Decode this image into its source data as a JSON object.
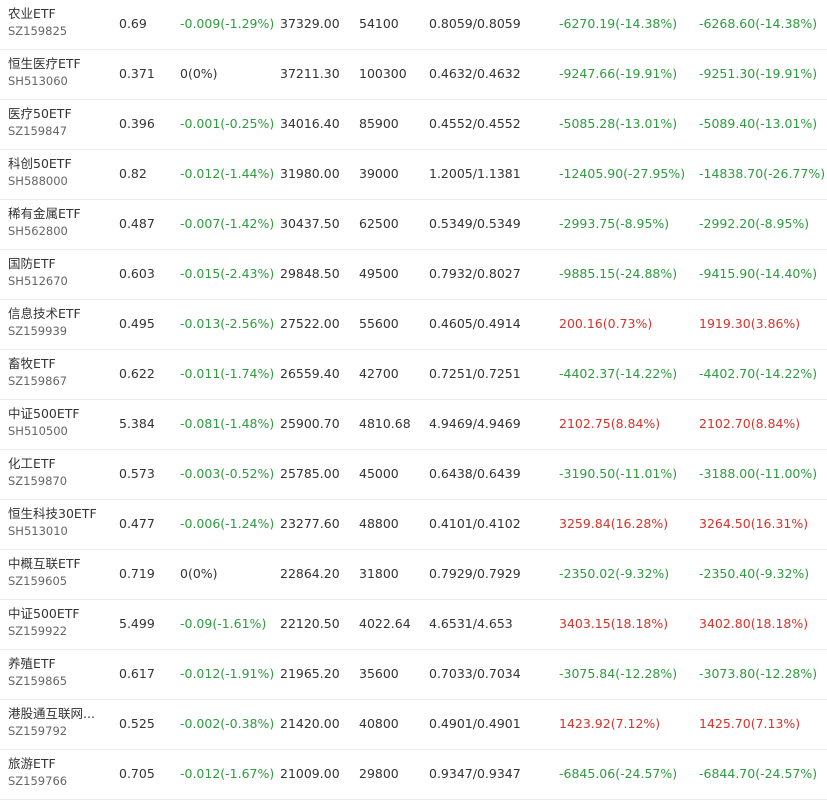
{
  "colors": {
    "up": "#d6332a",
    "down": "#2e9b3e",
    "flat": "#333333"
  },
  "rows": [
    {
      "name": "农业ETF",
      "code": "SZ159825",
      "price": "0.69",
      "change": "-0.009(-1.29%)",
      "change_dir": "down",
      "market_value": "37329.00",
      "shares": "54100",
      "cost": "0.8059/0.8059",
      "pnl1": "-6270.19(-14.38%)",
      "pnl1_dir": "down",
      "pnl2": "-6268.60(-14.38%)",
      "pnl2_dir": "down"
    },
    {
      "name": "恒生医疗ETF",
      "code": "SH513060",
      "price": "0.371",
      "change": "0(0%)",
      "change_dir": "flat",
      "market_value": "37211.30",
      "shares": "100300",
      "cost": "0.4632/0.4632",
      "pnl1": "-9247.66(-19.91%)",
      "pnl1_dir": "down",
      "pnl2": "-9251.30(-19.91%)",
      "pnl2_dir": "down"
    },
    {
      "name": "医疗50ETF",
      "code": "SZ159847",
      "price": "0.396",
      "change": "-0.001(-0.25%)",
      "change_dir": "down",
      "market_value": "34016.40",
      "shares": "85900",
      "cost": "0.4552/0.4552",
      "pnl1": "-5085.28(-13.01%)",
      "pnl1_dir": "down",
      "pnl2": "-5089.40(-13.01%)",
      "pnl2_dir": "down"
    },
    {
      "name": "科创50ETF",
      "code": "SH588000",
      "price": "0.82",
      "change": "-0.012(-1.44%)",
      "change_dir": "down",
      "market_value": "31980.00",
      "shares": "39000",
      "cost": "1.2005/1.1381",
      "pnl1": "-12405.90(-27.95%)",
      "pnl1_dir": "down",
      "pnl2": "-14838.70(-26.77%)",
      "pnl2_dir": "down"
    },
    {
      "name": "稀有金属ETF",
      "code": "SH562800",
      "price": "0.487",
      "change": "-0.007(-1.42%)",
      "change_dir": "down",
      "market_value": "30437.50",
      "shares": "62500",
      "cost": "0.5349/0.5349",
      "pnl1": "-2993.75(-8.95%)",
      "pnl1_dir": "down",
      "pnl2": "-2992.20(-8.95%)",
      "pnl2_dir": "down"
    },
    {
      "name": "国防ETF",
      "code": "SH512670",
      "price": "0.603",
      "change": "-0.015(-2.43%)",
      "change_dir": "down",
      "market_value": "29848.50",
      "shares": "49500",
      "cost": "0.7932/0.8027",
      "pnl1": "-9885.15(-24.88%)",
      "pnl1_dir": "down",
      "pnl2": "-9415.90(-14.40%)",
      "pnl2_dir": "down"
    },
    {
      "name": "信息技术ETF",
      "code": "SZ159939",
      "price": "0.495",
      "change": "-0.013(-2.56%)",
      "change_dir": "down",
      "market_value": "27522.00",
      "shares": "55600",
      "cost": "0.4605/0.4914",
      "pnl1": "200.16(0.73%)",
      "pnl1_dir": "up",
      "pnl2": "1919.30(3.86%)",
      "pnl2_dir": "up"
    },
    {
      "name": "畜牧ETF",
      "code": "SZ159867",
      "price": "0.622",
      "change": "-0.011(-1.74%)",
      "change_dir": "down",
      "market_value": "26559.40",
      "shares": "42700",
      "cost": "0.7251/0.7251",
      "pnl1": "-4402.37(-14.22%)",
      "pnl1_dir": "down",
      "pnl2": "-4402.70(-14.22%)",
      "pnl2_dir": "down"
    },
    {
      "name": "中证500ETF",
      "code": "SH510500",
      "price": "5.384",
      "change": "-0.081(-1.48%)",
      "change_dir": "down",
      "market_value": "25900.70",
      "shares": "4810.68",
      "cost": "4.9469/4.9469",
      "pnl1": "2102.75(8.84%)",
      "pnl1_dir": "up",
      "pnl2": "2102.70(8.84%)",
      "pnl2_dir": "up"
    },
    {
      "name": "化工ETF",
      "code": "SZ159870",
      "price": "0.573",
      "change": "-0.003(-0.52%)",
      "change_dir": "down",
      "market_value": "25785.00",
      "shares": "45000",
      "cost": "0.6438/0.6439",
      "pnl1": "-3190.50(-11.01%)",
      "pnl1_dir": "down",
      "pnl2": "-3188.00(-11.00%)",
      "pnl2_dir": "down"
    },
    {
      "name": "恒生科技30ETF",
      "code": "SH513010",
      "price": "0.477",
      "change": "-0.006(-1.24%)",
      "change_dir": "down",
      "market_value": "23277.60",
      "shares": "48800",
      "cost": "0.4101/0.4102",
      "pnl1": "3259.84(16.28%)",
      "pnl1_dir": "up",
      "pnl2": "3264.50(16.31%)",
      "pnl2_dir": "up"
    },
    {
      "name": "中概互联ETF",
      "code": "SZ159605",
      "price": "0.719",
      "change": "0(0%)",
      "change_dir": "flat",
      "market_value": "22864.20",
      "shares": "31800",
      "cost": "0.7929/0.7929",
      "pnl1": "-2350.02(-9.32%)",
      "pnl1_dir": "down",
      "pnl2": "-2350.40(-9.32%)",
      "pnl2_dir": "down"
    },
    {
      "name": "中证500ETF",
      "code": "SZ159922",
      "price": "5.499",
      "change": "-0.09(-1.61%)",
      "change_dir": "down",
      "market_value": "22120.50",
      "shares": "4022.64",
      "cost": "4.6531/4.653",
      "pnl1": "3403.15(18.18%)",
      "pnl1_dir": "up",
      "pnl2": "3402.80(18.18%)",
      "pnl2_dir": "up"
    },
    {
      "name": "养殖ETF",
      "code": "SZ159865",
      "price": "0.617",
      "change": "-0.012(-1.91%)",
      "change_dir": "down",
      "market_value": "21965.20",
      "shares": "35600",
      "cost": "0.7033/0.7034",
      "pnl1": "-3075.84(-12.28%)",
      "pnl1_dir": "down",
      "pnl2": "-3073.80(-12.28%)",
      "pnl2_dir": "down"
    },
    {
      "name": "港股通互联网...",
      "code": "SZ159792",
      "price": "0.525",
      "change": "-0.002(-0.38%)",
      "change_dir": "down",
      "market_value": "21420.00",
      "shares": "40800",
      "cost": "0.4901/0.4901",
      "pnl1": "1423.92(7.12%)",
      "pnl1_dir": "up",
      "pnl2": "1425.70(7.13%)",
      "pnl2_dir": "up"
    },
    {
      "name": "旅游ETF",
      "code": "SZ159766",
      "price": "0.705",
      "change": "-0.012(-1.67%)",
      "change_dir": "down",
      "market_value": "21009.00",
      "shares": "29800",
      "cost": "0.9347/0.9347",
      "pnl1": "-6845.06(-24.57%)",
      "pnl1_dir": "down",
      "pnl2": "-6844.70(-24.57%)",
      "pnl2_dir": "down"
    }
  ]
}
